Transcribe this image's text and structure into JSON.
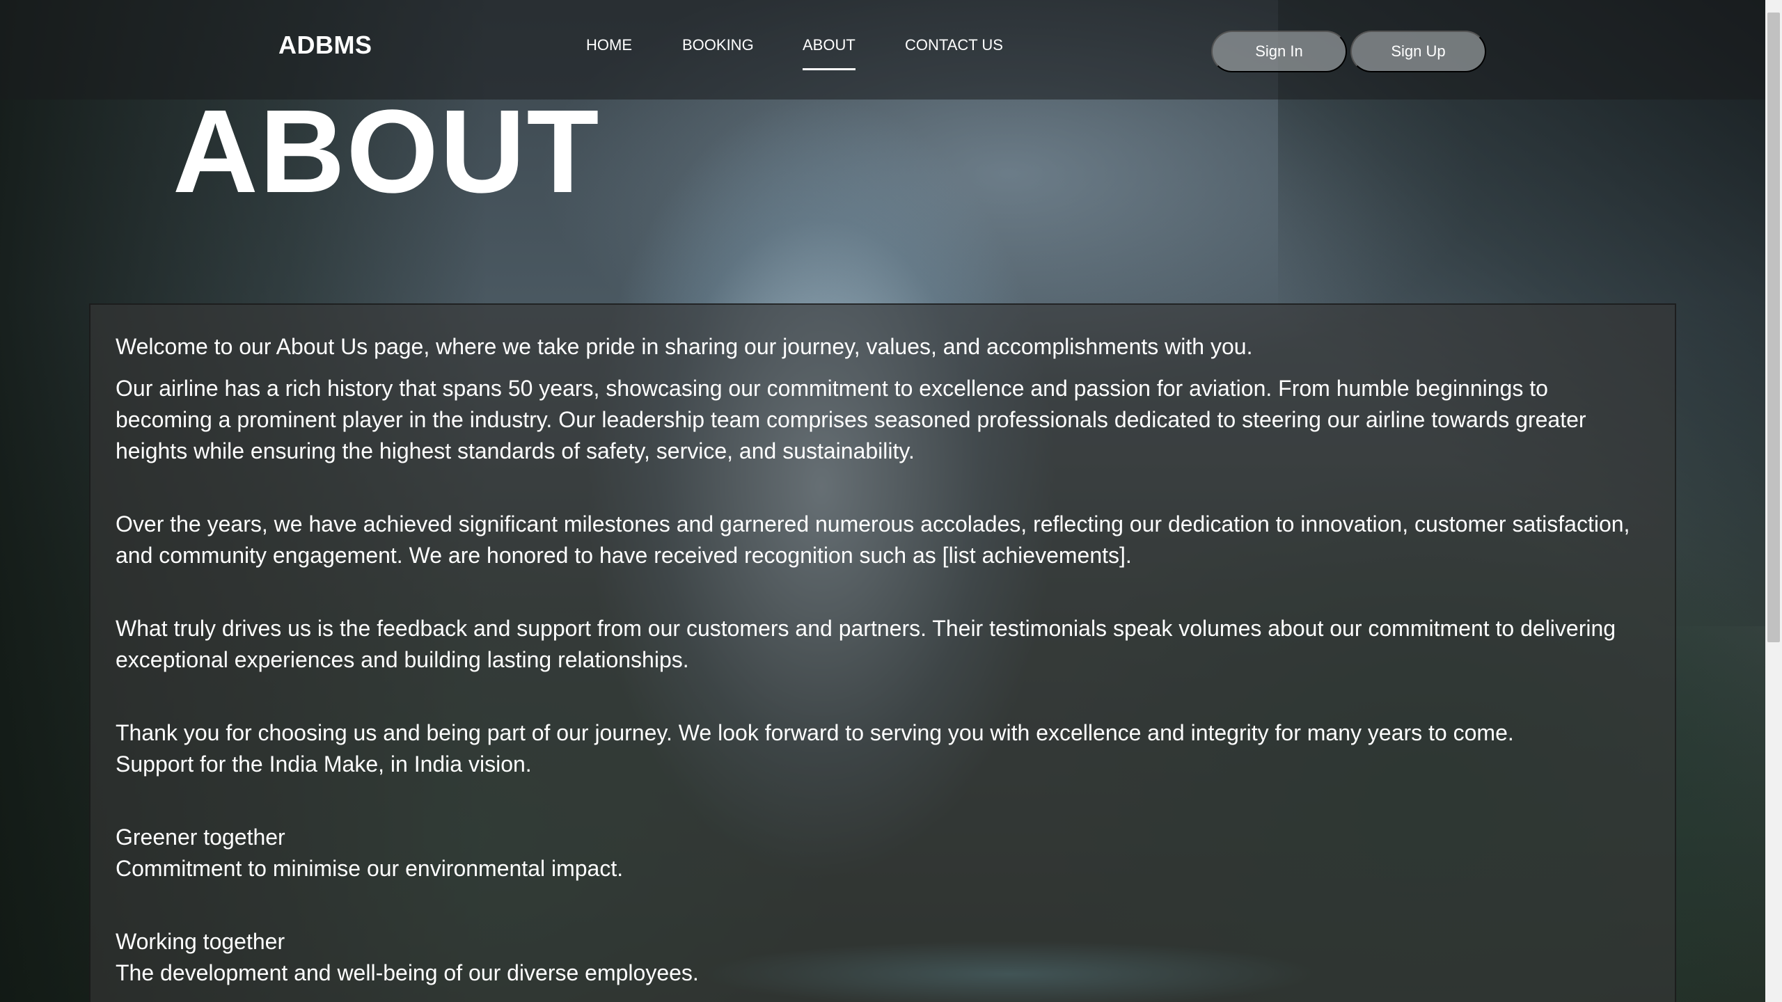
{
  "brand": {
    "logo": "ADBMS"
  },
  "nav": {
    "items": [
      {
        "label": "HOME"
      },
      {
        "label": "BOOKING"
      },
      {
        "label": "ABOUT",
        "active": true
      },
      {
        "label": "CONTACT US"
      }
    ],
    "sign_in": "Sign In",
    "sign_up": "Sign Up"
  },
  "page": {
    "title": "ABOUT",
    "paragraphs": {
      "intro": "Welcome to our About Us page, where we take pride in sharing our journey, values, and accomplishments with you.",
      "history": "Our airline has a rich history that spans 50 years, showcasing our commitment to excellence and passion for aviation. From humble beginnings to becoming a prominent player in the industry. Our leadership team comprises seasoned professionals dedicated to steering our airline towards greater heights while ensuring the highest standards of safety, service, and sustainability.",
      "milestones": "Over the years, we have achieved significant milestones and garnered numerous accolades, reflecting our dedication to innovation, customer satisfaction, and community engagement. We are honored to have received recognition such as [list achievements].",
      "feedback": "What truly drives us is the feedback and support from our customers and partners. Their testimonials speak volumes about our commitment to delivering exceptional experiences and building lasting relationships.",
      "thanks_line1": "Thank you for choosing us and being part of our journey. We look forward to serving you with excellence and integrity for many years to come.",
      "thanks_line2": "Support for the India Make, in India vision.",
      "greener_title": "Greener together",
      "greener_text": "Commitment to minimise our environmental impact.",
      "working_title": "Working together",
      "working_text": "The development and well-being of our diverse employees."
    }
  },
  "colors": {
    "text": "#ffffff",
    "navbar_bg": "#1c1e20",
    "button_bg": "#96999e",
    "content_bg": "#373737"
  }
}
